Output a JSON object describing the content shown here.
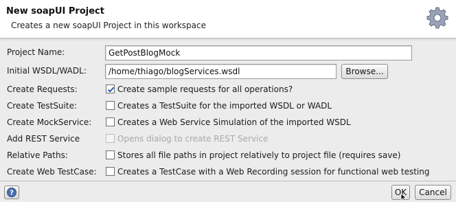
{
  "header": {
    "title": "New soapUI Project",
    "subtitle": "Creates a new soapUI Project in this workspace",
    "icon": "gear-icon"
  },
  "form": {
    "project_name": {
      "label": "Project Name:",
      "value": "GetPostBlogMock"
    },
    "initial_wsdl": {
      "label": "Initial WSDL/WADL:",
      "value": "/home/thiago/blogServices.wsdl",
      "browse_label": "Browse..."
    },
    "options": [
      {
        "label": "Create Requests:",
        "text": "Create sample requests for all operations?",
        "checked": true,
        "enabled": true
      },
      {
        "label": "Create TestSuite:",
        "text": "Creates a TestSuite for the imported WSDL or WADL",
        "checked": false,
        "enabled": true
      },
      {
        "label": "Create MockService:",
        "text": "Creates a Web Service Simulation of the imported WSDL",
        "checked": false,
        "enabled": true
      },
      {
        "label": "Add REST Service",
        "text": "Opens dialog to create REST Service",
        "checked": false,
        "enabled": false
      },
      {
        "label": "Relative Paths:",
        "text": "Stores all file paths in project relatively to project file (requires save)",
        "checked": false,
        "enabled": true
      },
      {
        "label": "Create Web TestCase:",
        "text": "Creates a TestCase with a Web Recording session for functional web testing",
        "checked": false,
        "enabled": true
      }
    ]
  },
  "footer": {
    "help_icon": "help-icon",
    "ok_label": "OK",
    "cancel_label": "Cancel"
  },
  "colors": {
    "dialog_bg": "#ececec",
    "header_bg": "#ffffff",
    "check_mark": "#2b5aa8"
  }
}
